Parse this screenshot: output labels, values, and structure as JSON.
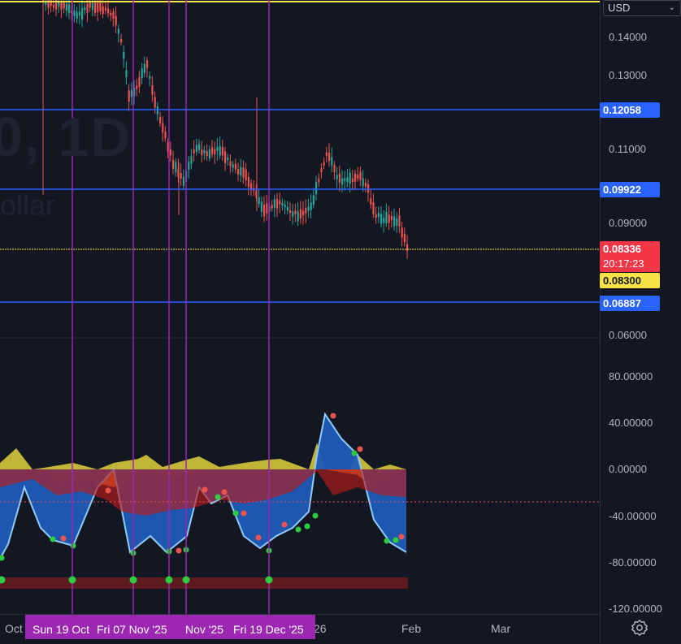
{
  "watermark": {
    "ticker": "0, 1D",
    "sub": "ollar"
  },
  "currency_label": "USD",
  "price_ticks": [
    "0.14000",
    "0.13000",
    "0.11000",
    "0.09000",
    "0.06000"
  ],
  "osc_ticks": [
    "80.00000",
    "40.00000",
    "0.00000",
    "-40.00000",
    "-80.00000",
    "-120.00000"
  ],
  "badges": {
    "level_1": "0.12058",
    "level_2": "0.09922",
    "last_price": "0.08336",
    "countdown": "20:17:23",
    "level_3": "0.08300",
    "level_4": "0.06887"
  },
  "time_axis": {
    "labels": [
      "Oct",
      "26",
      "Feb",
      "Mar"
    ],
    "vline_labels": [
      "Sun 19 Oct",
      "Fri 07 Nov '25",
      "Nov '25",
      "Fri 19 Dec '25"
    ]
  },
  "colors": {
    "background": "#131722",
    "up": "#26a69a",
    "down": "#ef5350",
    "blue_level": "#2962ff",
    "yellow_level": "#f7e245",
    "vline": "#9c27b0"
  },
  "icons": {
    "settings": "gear-icon",
    "dropdown": "chevron-down-icon"
  }
}
